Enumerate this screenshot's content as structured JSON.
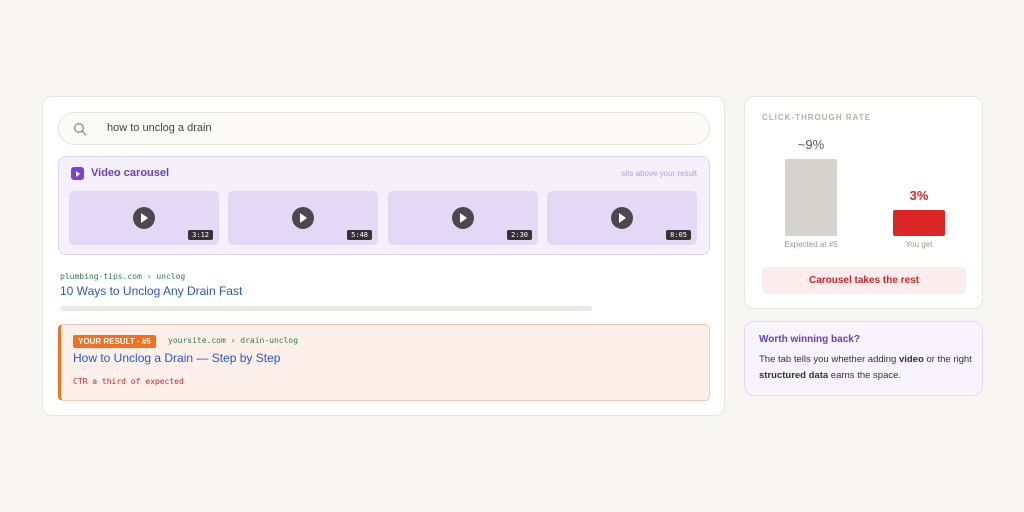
{
  "search": {
    "query": "how to unclog a drain"
  },
  "carousel": {
    "title": "Video carousel",
    "note": "sits above your result",
    "videos": [
      {
        "duration": "3:12"
      },
      {
        "duration": "5:48"
      },
      {
        "duration": "2:30"
      },
      {
        "duration": "8:05"
      }
    ]
  },
  "result1": {
    "url": "plumbing-tips.com › unclog",
    "title": "10 Ways to Unclog Any Drain Fast"
  },
  "your_result": {
    "badge": "YOUR RESULT · #5",
    "url": "yoursite.com › drain-unclog",
    "title": "How to Unclog a Drain — Step by Step",
    "ctr_note": "CTR a third of expected"
  },
  "ctr_panel": {
    "heading": "CLICK-THROUGH RATE",
    "callout": "Carousel takes the rest"
  },
  "chart_data": {
    "type": "bar",
    "title": "CLICK-THROUGH RATE",
    "categories": [
      "Expected at #5",
      "You get"
    ],
    "values": [
      9,
      3
    ],
    "value_labels": [
      "~9%",
      "3%"
    ],
    "ylim": [
      0,
      9
    ],
    "colors": [
      "#d6d2cc",
      "#dc2626"
    ],
    "label_colors": [
      "#555555",
      "#dc2626"
    ]
  },
  "info": {
    "heading": "Worth winning back?",
    "text_1": "The tab tells you whether adding ",
    "bold_1": "video",
    "text_2": " or the right ",
    "bold_2": "structured data",
    "text_3": " earns the space."
  },
  "colors": {
    "accent_purple": "#6a3ec2",
    "accent_orange": "#f37021",
    "alert_red": "#c62828",
    "link_blue": "#2a56c6"
  }
}
